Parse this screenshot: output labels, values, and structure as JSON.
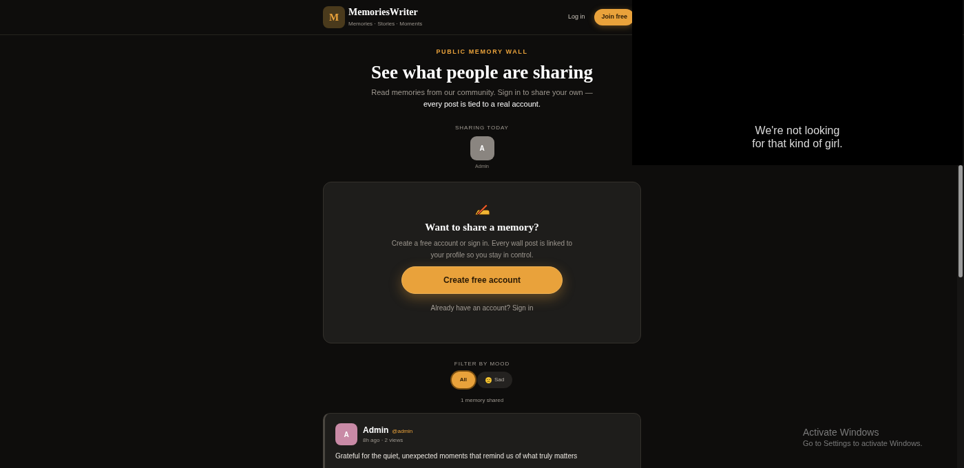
{
  "header": {
    "logo_letter": "M",
    "brand": "MemoriesWriter",
    "tagline": "Memories · Stories · Moments",
    "login": "Log in",
    "join": "Join free"
  },
  "hero": {
    "eyebrow": "PUBLIC MEMORY WALL",
    "title": "See what people are sharing",
    "subtitle": "Read memories from our community. Sign in to share your own — **every post is tied to a real account.**"
  },
  "sharing_today": {
    "label": "SHARING TODAY",
    "users": [
      {
        "initial": "A",
        "name": "Admin",
        "color": "#8a8580"
      }
    ]
  },
  "cta": {
    "title": "Want to share a memory?",
    "text": "Create a free account or sign in. Every wall post is linked to your profile so you stay in control.",
    "button": "Create free account",
    "signin": "Already have an account? Sign in"
  },
  "filter": {
    "label": "FILTER BY MOOD",
    "moods": [
      {
        "label": "All",
        "kind": "all",
        "selected": true
      },
      {
        "label": "Sad",
        "kind": "mood",
        "selected": false
      }
    ],
    "count": "1 memory shared"
  },
  "posts": [
    {
      "initial": "A",
      "color": "#c98aa6",
      "name": "Admin",
      "handle": "@admin",
      "meta": "8h ago · 2 views",
      "text": "Grateful for the quiet, unexpected moments that remind us of what truly matters"
    }
  ],
  "video": {
    "caption_lines": [
      "We're not looking",
      "for that kind of girl."
    ]
  },
  "os_notice": {
    "title": "Activate Windows",
    "text": "Go to Settings to activate Windows."
  }
}
